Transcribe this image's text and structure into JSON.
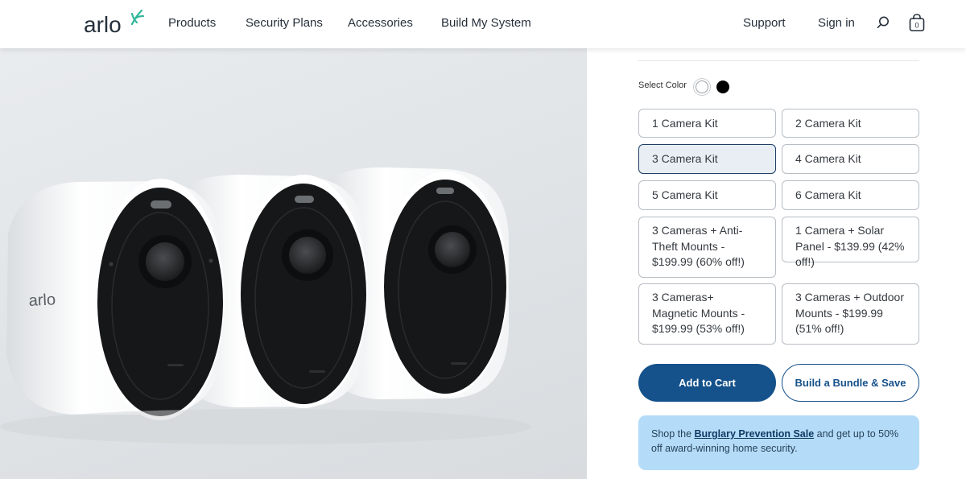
{
  "header": {
    "logo_text": "arlo",
    "nav": [
      "Products",
      "Security Plans",
      "Accessories",
      "Build My System"
    ],
    "support_label": "Support",
    "signin_label": "Sign in",
    "cart_count": "0"
  },
  "product_image": {
    "camera_brand_text": "arlo"
  },
  "panel": {
    "color_label": "Select Color",
    "colors": [
      "#ffffff",
      "#000000"
    ],
    "options": [
      "1 Camera Kit",
      "2 Camera Kit",
      "3 Camera Kit",
      "4 Camera Kit",
      "5 Camera Kit",
      "6 Camera Kit",
      "3 Cameras + Anti-Theft Mounts - $199.99 (60% off!)",
      "1 Camera + Solar Panel - $139.99 (42% off!)",
      "3 Cameras+ Magnetic Mounts - $199.99 (53% off!)",
      "3 Cameras + Outdoor Mounts - $199.99 (51% off!)"
    ],
    "selected_option": "3 Camera Kit",
    "add_to_cart_label": "Add to Cart",
    "bundle_label": "Build a Bundle & Save",
    "promo": {
      "prefix": "Shop the ",
      "link": "Burglary Prevention Sale",
      "suffix": " and get up to 50% off award-winning home security."
    }
  },
  "colors": {
    "brand_teal": "#2fb79a",
    "primary_blue": "#15518a",
    "promo_bg": "#b4dcf8"
  }
}
